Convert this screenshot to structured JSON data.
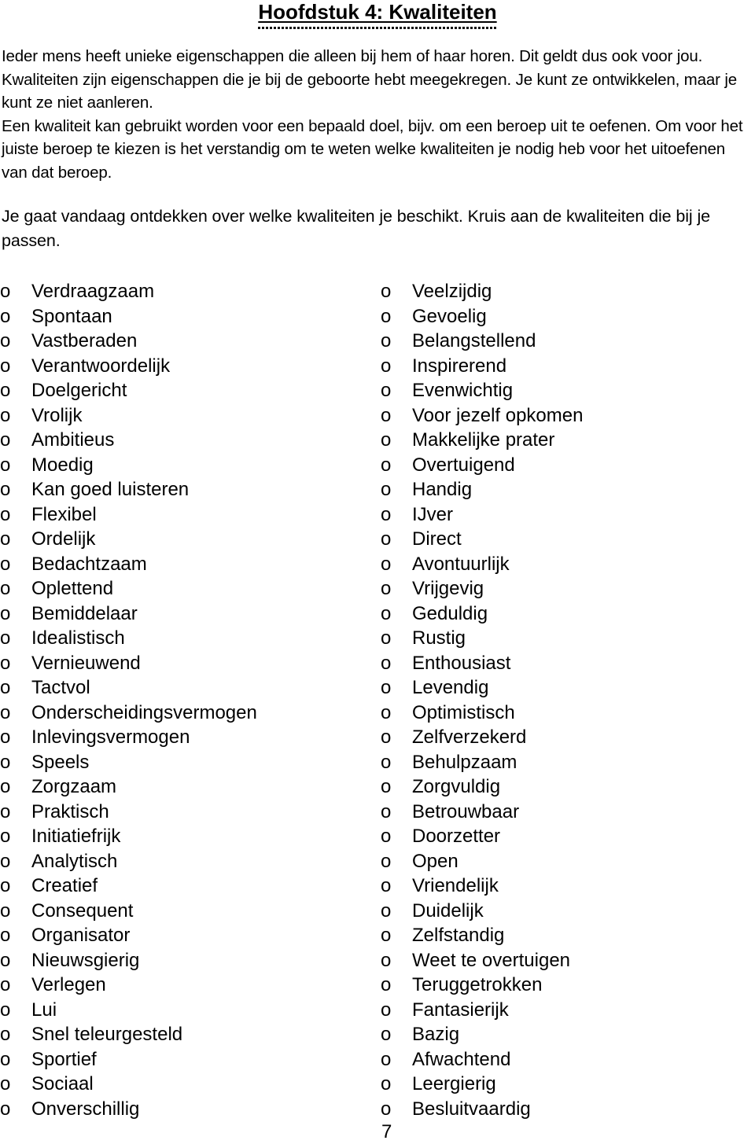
{
  "page": {
    "title": "Hoofdstuk 4: Kwaliteiten",
    "intro_paragraph_1": "Ieder mens heeft unieke eigenschappen die alleen bij hem of haar horen. Dit geldt dus ook voor jou. Kwaliteiten zijn eigenschappen die je bij de geboorte hebt meegekregen. Je kunt ze ontwikkelen, maar je kunt ze niet aanleren.",
    "intro_paragraph_2": "Een kwaliteit kan gebruikt worden voor een bepaald doel, bijv. om een beroep uit te oefenen. Om voor het juiste beroep te kiezen is het verstandig om te weten welke kwaliteiten je nodig heb voor het uitoefenen van dat beroep.",
    "task_instruction": "Je gaat vandaag ontdekken over welke kwaliteiten je beschikt. Kruis aan de kwaliteiten die bij je passen.",
    "bullet_symbol": "o",
    "page_number": "7"
  },
  "checklist": {
    "left_column": [
      "Verdraagzaam",
      "Spontaan",
      "Vastberaden",
      "Verantwoordelijk",
      "Doelgericht",
      "Vrolijk",
      "Ambitieus",
      "Moedig",
      "Kan goed luisteren",
      "Flexibel",
      "Ordelijk",
      "Bedachtzaam",
      "Oplettend",
      "Bemiddelaar",
      "Idealistisch",
      "Vernieuwend",
      "Tactvol",
      "Onderscheidingsvermogen",
      "Inlevingsvermogen",
      "Speels",
      "Zorgzaam",
      "Praktisch",
      "Initiatiefrijk",
      "Analytisch",
      "Creatief",
      "Consequent",
      "Organisator",
      "Nieuwsgierig",
      "Verlegen",
      "Lui",
      "Snel teleurgesteld",
      "Sportief",
      "Sociaal",
      "Onverschillig"
    ],
    "right_column": [
      "Veelzijdig",
      "Gevoelig",
      "Belangstellend",
      "Inspirerend",
      "Evenwichtig",
      "Voor jezelf opkomen",
      "Makkelijke prater",
      "Overtuigend",
      "Handig",
      "IJver",
      "Direct",
      "Avontuurlijk",
      "Vrijgevig",
      "Geduldig",
      "Rustig",
      "Enthousiast",
      "Levendig",
      "Optimistisch",
      "Zelfverzekerd",
      "Behulpzaam",
      "Zorgvuldig",
      "Betrouwbaar",
      "Doorzetter",
      "Open",
      "Vriendelijk",
      "Duidelijk",
      "Zelfstandig",
      "Weet te overtuigen",
      "Teruggetrokken",
      "Fantasierijk",
      "Bazig",
      "Afwachtend",
      "Leergierig",
      "Besluitvaardig"
    ]
  }
}
